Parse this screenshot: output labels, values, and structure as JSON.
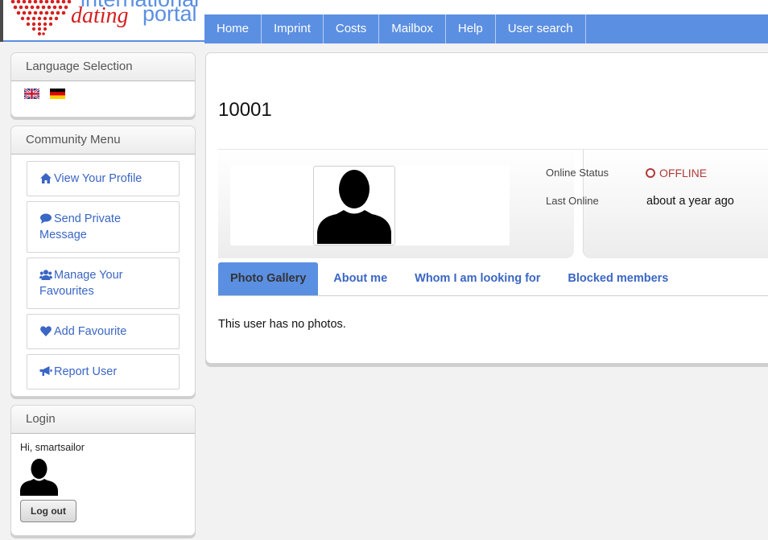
{
  "header": {
    "logo_line1": "international",
    "logo_word_dating": "dating",
    "logo_word_portal": "portal",
    "nav": [
      "Home",
      "Imprint",
      "Costs",
      "Mailbox",
      "Help",
      "User search"
    ]
  },
  "sidebar": {
    "language": {
      "title": "Language Selection",
      "flags": [
        "english-flag-icon",
        "german-flag-icon"
      ]
    },
    "community": {
      "title": "Community Menu",
      "items": [
        {
          "icon": "home-icon",
          "label": "View Your Profile"
        },
        {
          "icon": "comment-icon",
          "label": "Send Private Message"
        },
        {
          "icon": "users-icon",
          "label": "Manage Your Favourites"
        },
        {
          "icon": "heart-icon",
          "label": "Add Favourite"
        },
        {
          "icon": "bullhorn-icon",
          "label": "Report User"
        }
      ]
    },
    "login": {
      "title": "Login",
      "greeting": "Hi, smartsailor",
      "logout_label": "Log out"
    }
  },
  "profile": {
    "id": "10001",
    "online_status_label": "Online Status",
    "online_status_value": "OFFLINE",
    "last_online_label": "Last Online",
    "last_online_value": "about a year ago",
    "tabs": [
      "Photo Gallery",
      "About me",
      "Whom I am looking for",
      "Blocked members"
    ],
    "active_tab": "Photo Gallery",
    "gallery_message": "This user has no photos."
  },
  "colors": {
    "accent": "#5b8fe2",
    "link": "#3a66c4",
    "logo_red": "#d62020",
    "offline": "#b03a3a"
  }
}
